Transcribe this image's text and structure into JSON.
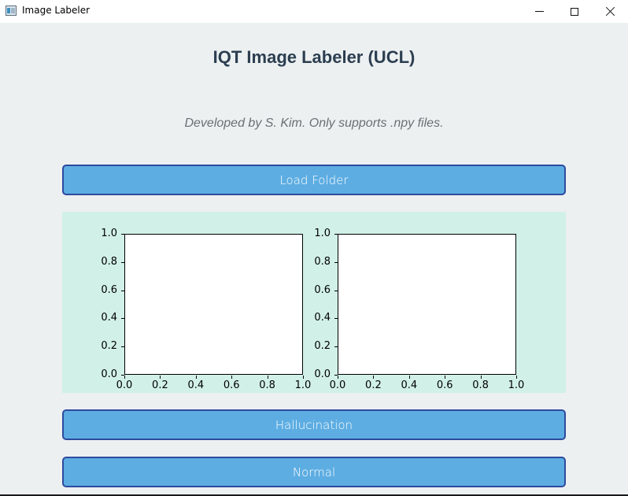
{
  "window": {
    "title": "Image Labeler",
    "icon": "app-window-icon",
    "controls": [
      "minimize-icon",
      "maximize-icon",
      "close-icon"
    ]
  },
  "header": {
    "title": "IQT Image Labeler (UCL)",
    "subtitle": "Developed by S. Kim. Only supports .npy files."
  },
  "buttons": {
    "load_folder": "Load Folder",
    "hallucination": "Hallucination",
    "normal": "Normal"
  },
  "colors": {
    "background": "#ecf0f1",
    "button_fill": "#5dade2",
    "button_border": "#2e4a9e",
    "plot_background": "#d1f0e8",
    "heading": "#2c3e50"
  },
  "chart_data": [
    {
      "type": "scatter",
      "title": "",
      "xlabel": "",
      "ylabel": "",
      "xlim": [
        0.0,
        1.0
      ],
      "ylim": [
        0.0,
        1.0
      ],
      "xticks": [
        "0.0",
        "0.2",
        "0.4",
        "0.6",
        "0.8",
        "1.0"
      ],
      "yticks": [
        "0.0",
        "0.2",
        "0.4",
        "0.6",
        "0.8",
        "1.0"
      ],
      "series": []
    },
    {
      "type": "scatter",
      "title": "",
      "xlabel": "",
      "ylabel": "",
      "xlim": [
        0.0,
        1.0
      ],
      "ylim": [
        0.0,
        1.0
      ],
      "xticks": [
        "0.0",
        "0.2",
        "0.4",
        "0.6",
        "0.8",
        "1.0"
      ],
      "yticks": [
        "0.0",
        "0.2",
        "0.4",
        "0.6",
        "0.8",
        "1.0"
      ],
      "series": []
    }
  ]
}
